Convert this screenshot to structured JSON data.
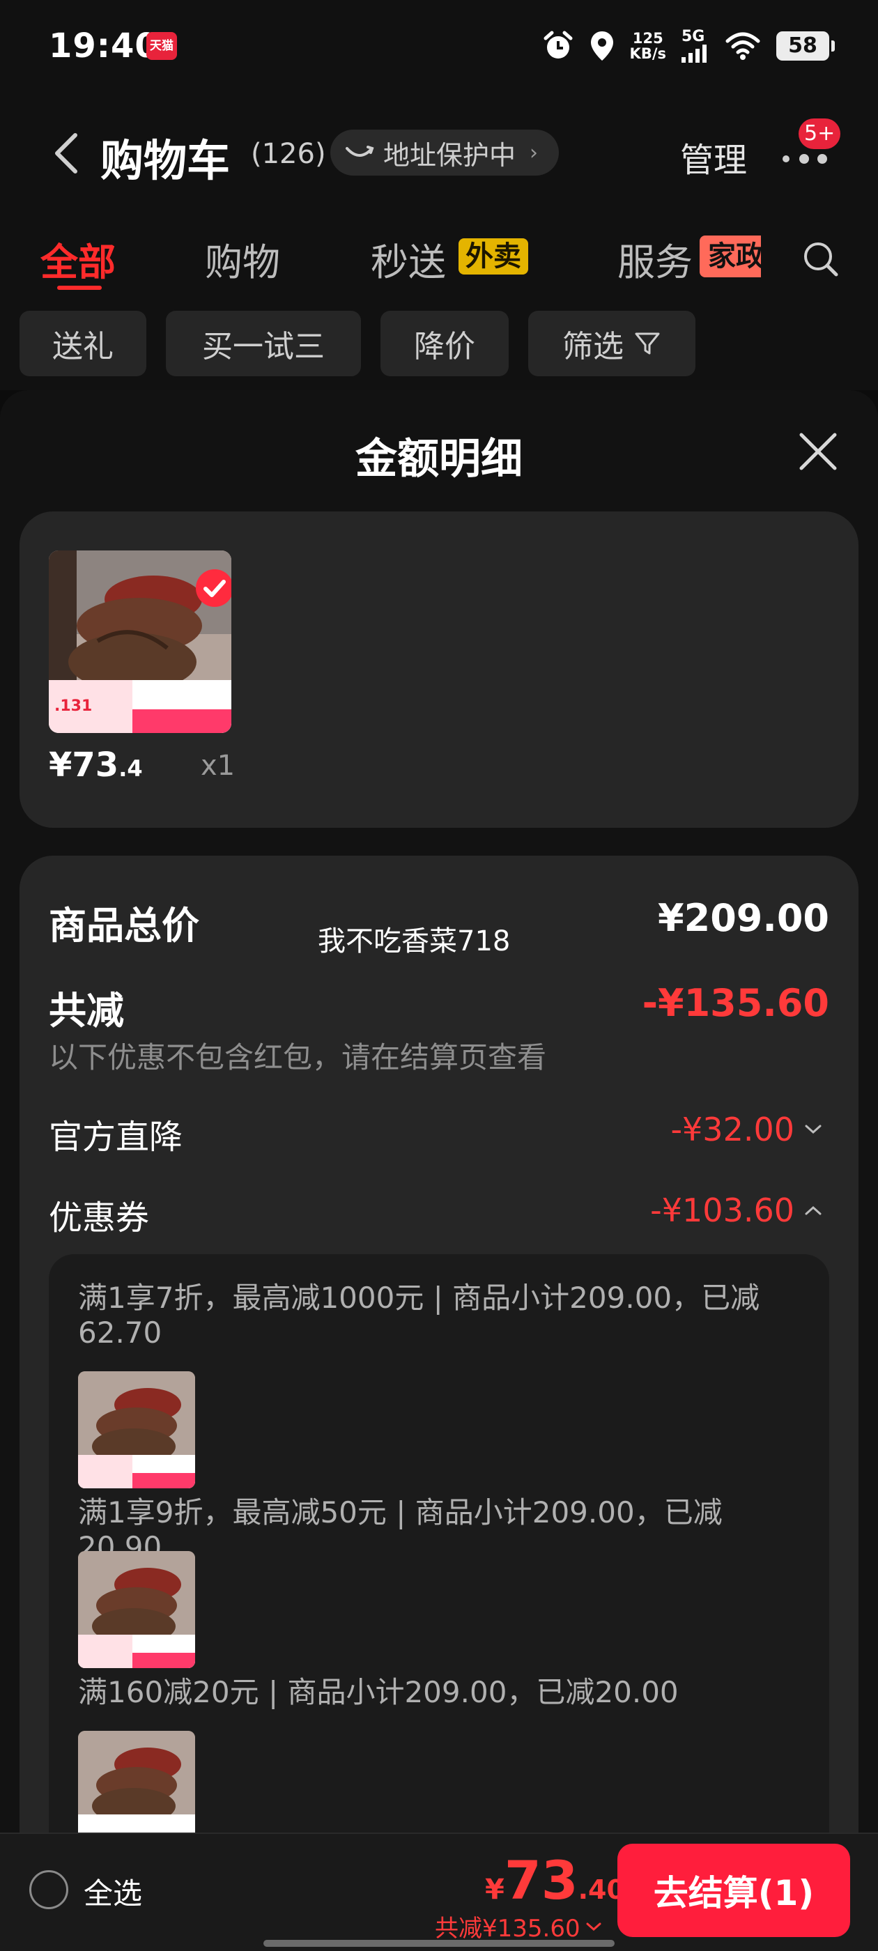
{
  "status_bar": {
    "time": "19:40",
    "app_badge": "天猫",
    "net_speed_value": "125",
    "net_speed_unit": "KB/s",
    "network": "5G",
    "battery": "58"
  },
  "header": {
    "title": "购物车",
    "count": "(126)",
    "address_pill": "地址保护中",
    "manage": "管理",
    "more_badge": "5+"
  },
  "tabs": [
    {
      "label": "全部"
    },
    {
      "label": "购物"
    },
    {
      "label": "秒送",
      "tag": "外卖"
    },
    {
      "label": "服务",
      "tag": "家政"
    }
  ],
  "filters": [
    {
      "label": "送礼"
    },
    {
      "label": "买一试三"
    },
    {
      "label": "降价"
    },
    {
      "label": "筛选"
    }
  ],
  "modal": {
    "title": "金额明细",
    "product": {
      "price_int": "¥73",
      "price_dec": ".4",
      "qty": "x1"
    },
    "summary": {
      "total_label": "商品总价",
      "total_value": "¥209.00",
      "watermark": "我不吃香菜718",
      "discount_label": "共减",
      "discount_value": "-¥135.60",
      "discount_note": "以下优惠不包含红包，请在结算页查看",
      "official_label": "官方直降",
      "official_value": "-¥32.00",
      "coupon_label": "优惠券",
      "coupon_value": "-¥103.60"
    },
    "coupons": [
      {
        "desc": "满1享7折，最高减1000元 | 商品小计209.00，已减62.70"
      },
      {
        "desc": "满1享9折，最高减50元 | 商品小计209.00，已减20.90"
      },
      {
        "desc": "满160减20元 | 商品小计209.00，已减20.00"
      }
    ]
  },
  "bottom_bar": {
    "select_all": "全选",
    "total_currency": "¥",
    "total_int": "73",
    "total_dec": ".40",
    "saved": "共减¥135.60",
    "checkout": "去结算(1)"
  },
  "colors": {
    "accent_red": "#ff2b2b",
    "price_red": "#ff3a3a",
    "checkout_red": "#ff1e3c",
    "tag_yellow": "#e4b400",
    "card_bg": "#262626",
    "page_bg": "#0c0c0c"
  },
  "icons": [
    "back-icon",
    "search-icon",
    "close-icon",
    "filter-icon",
    "check-icon",
    "more-icon",
    "alarm-icon",
    "location-icon",
    "wifi-icon",
    "signal-icon",
    "smile-icon"
  ]
}
